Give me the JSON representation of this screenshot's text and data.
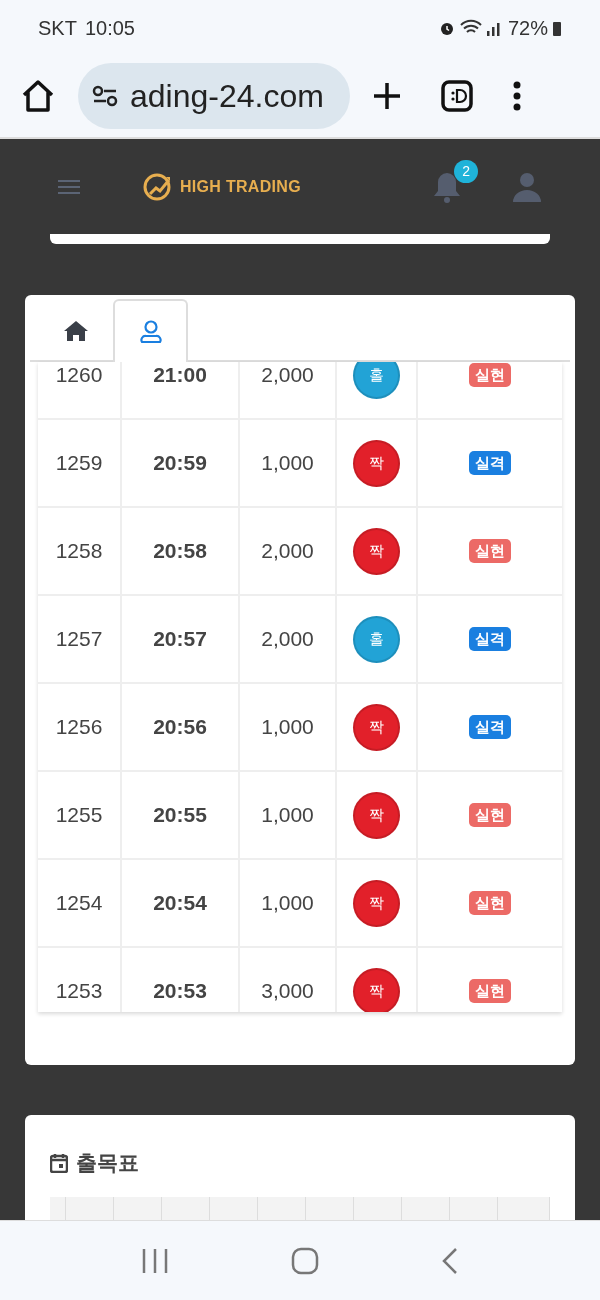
{
  "status_bar": {
    "carrier": "SKT",
    "time": "10:05",
    "battery": "72%"
  },
  "browser": {
    "url": "ading-24.com"
  },
  "header": {
    "logo": "HIGH TRADING",
    "notification_count": "2"
  },
  "tabs": [
    {
      "selected": false
    },
    {
      "selected": true
    }
  ],
  "rows": [
    {
      "round": "1260",
      "time": "21:00",
      "amount": "2,000",
      "pick": {
        "text": "홀",
        "color": "#22a3d6"
      },
      "result": {
        "text": "실현",
        "color": "#ec6a66"
      }
    },
    {
      "round": "1259",
      "time": "20:59",
      "amount": "1,000",
      "pick": {
        "text": "짝",
        "color": "#e2202a"
      },
      "result": {
        "text": "실격",
        "color": "#1a7fe0"
      }
    },
    {
      "round": "1258",
      "time": "20:58",
      "amount": "2,000",
      "pick": {
        "text": "짝",
        "color": "#e2202a"
      },
      "result": {
        "text": "실현",
        "color": "#ec6a66"
      }
    },
    {
      "round": "1257",
      "time": "20:57",
      "amount": "2,000",
      "pick": {
        "text": "홀",
        "color": "#22a3d6"
      },
      "result": {
        "text": "실격",
        "color": "#1a7fe0"
      }
    },
    {
      "round": "1256",
      "time": "20:56",
      "amount": "1,000",
      "pick": {
        "text": "짝",
        "color": "#e2202a"
      },
      "result": {
        "text": "실격",
        "color": "#1a7fe0"
      }
    },
    {
      "round": "1255",
      "time": "20:55",
      "amount": "1,000",
      "pick": {
        "text": "짝",
        "color": "#e2202a"
      },
      "result": {
        "text": "실현",
        "color": "#ec6a66"
      }
    },
    {
      "round": "1254",
      "time": "20:54",
      "amount": "1,000",
      "pick": {
        "text": "짝",
        "color": "#e2202a"
      },
      "result": {
        "text": "실현",
        "color": "#ec6a66"
      }
    },
    {
      "round": "1253",
      "time": "20:53",
      "amount": "3,000",
      "pick": {
        "text": "짝",
        "color": "#e2202a"
      },
      "result": {
        "text": "실현",
        "color": "#ec6a66"
      }
    }
  ],
  "section": {
    "title": "출목표"
  }
}
